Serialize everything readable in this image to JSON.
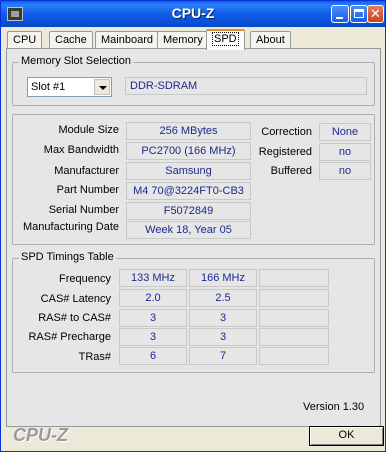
{
  "window": {
    "title": "CPU-Z"
  },
  "tabs": [
    {
      "label": "CPU",
      "active": false
    },
    {
      "label": "Cache",
      "active": false
    },
    {
      "label": "Mainboard",
      "active": false
    },
    {
      "label": "Memory",
      "active": false
    },
    {
      "label": "SPD",
      "active": true
    },
    {
      "label": "About",
      "active": false
    }
  ],
  "slot_selection": {
    "group_label": "Memory Slot Selection",
    "slot_value": "Slot #1",
    "memory_type": "DDR-SDRAM"
  },
  "module": {
    "module_size": {
      "label": "Module Size",
      "value": "256 MBytes"
    },
    "max_bandwidth": {
      "label": "Max Bandwidth",
      "value": "PC2700 (166 MHz)"
    },
    "manufacturer": {
      "label": "Manufacturer",
      "value": "Samsung"
    },
    "part_number": {
      "label": "Part Number",
      "value": "M4 70@3224FT0-CB3"
    },
    "serial_number": {
      "label": "Serial Number",
      "value": "F5072849"
    },
    "manufacturing_date": {
      "label": "Manufacturing Date",
      "value": "Week 18, Year 05"
    },
    "correction": {
      "label": "Correction",
      "value": "None"
    },
    "registered": {
      "label": "Registered",
      "value": "no"
    },
    "buffered": {
      "label": "Buffered",
      "value": "no"
    }
  },
  "timings": {
    "group_label": "SPD Timings Table",
    "rows": [
      {
        "label": "Frequency",
        "values": [
          "133 MHz",
          "166 MHz",
          ""
        ]
      },
      {
        "label": "CAS# Latency",
        "values": [
          "2.0",
          "2.5",
          ""
        ]
      },
      {
        "label": "RAS# to CAS#",
        "values": [
          "3",
          "3",
          ""
        ]
      },
      {
        "label": "RAS# Precharge",
        "values": [
          "3",
          "3",
          ""
        ]
      },
      {
        "label": "TRas#",
        "values": [
          "6",
          "7",
          ""
        ]
      }
    ]
  },
  "footer": {
    "version": "Version 1.30",
    "brand": "CPU-Z",
    "ok_label": "OK"
  }
}
